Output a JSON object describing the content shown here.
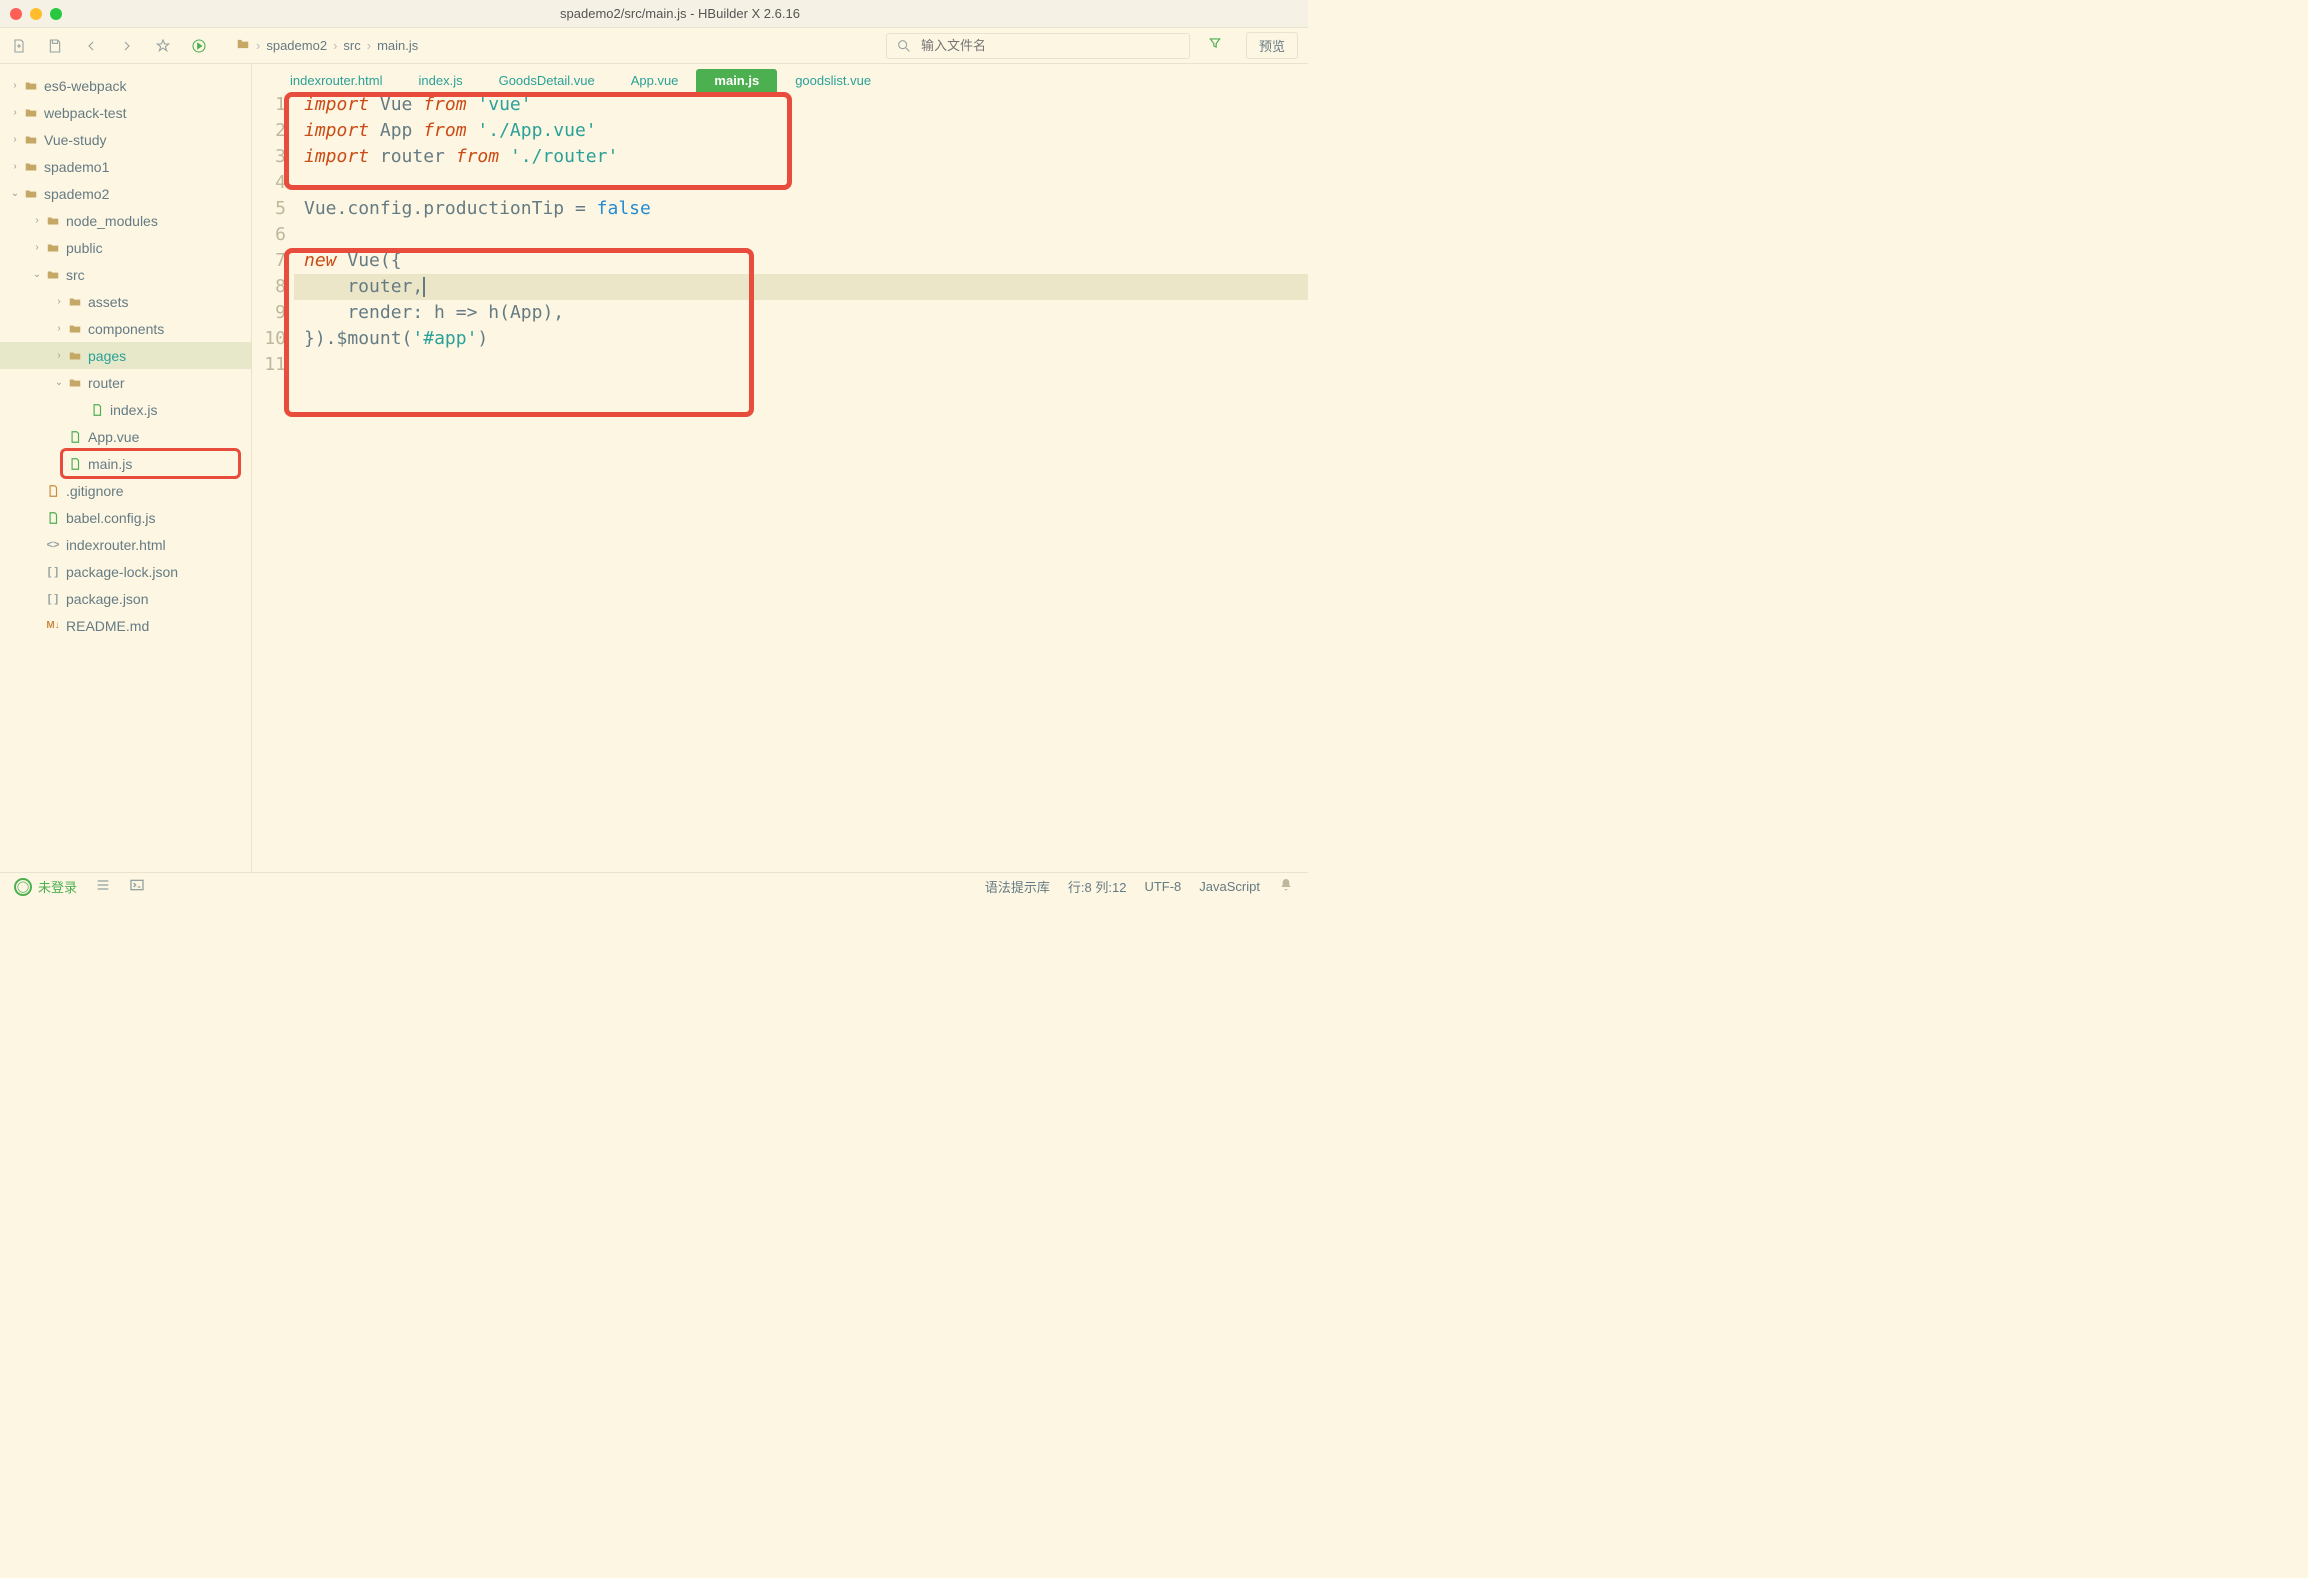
{
  "window": {
    "title": "spademo2/src/main.js - HBuilder X 2.6.16"
  },
  "toolbar": {
    "breadcrumb": [
      "spademo2",
      "src",
      "main.js"
    ],
    "search_placeholder": "输入文件名",
    "preview_label": "预览"
  },
  "sidebar": {
    "items": [
      {
        "depth": 0,
        "icon": "folder",
        "arrow": ">",
        "label": "es6-webpack"
      },
      {
        "depth": 0,
        "icon": "folder",
        "arrow": ">",
        "label": "webpack-test"
      },
      {
        "depth": 0,
        "icon": "folder",
        "arrow": ">",
        "label": "Vue-study"
      },
      {
        "depth": 0,
        "icon": "folder",
        "arrow": ">",
        "label": "spademo1"
      },
      {
        "depth": 0,
        "icon": "folder",
        "arrow": "v",
        "label": "spademo2"
      },
      {
        "depth": 1,
        "icon": "folder",
        "arrow": ">",
        "label": "node_modules"
      },
      {
        "depth": 1,
        "icon": "folder",
        "arrow": ">",
        "label": "public"
      },
      {
        "depth": 1,
        "icon": "folder",
        "arrow": "v",
        "label": "src"
      },
      {
        "depth": 2,
        "icon": "folder",
        "arrow": ">",
        "label": "assets"
      },
      {
        "depth": 2,
        "icon": "folder",
        "arrow": ">",
        "label": "components"
      },
      {
        "depth": 2,
        "icon": "folder",
        "arrow": ">",
        "label": "pages",
        "active": true
      },
      {
        "depth": 2,
        "icon": "folder",
        "arrow": "v",
        "label": "router"
      },
      {
        "depth": 3,
        "icon": "file-js",
        "arrow": "",
        "label": "index.js"
      },
      {
        "depth": 2,
        "icon": "file-vue",
        "arrow": "",
        "label": "App.vue"
      },
      {
        "depth": 2,
        "icon": "file-js",
        "arrow": "",
        "label": "main.js",
        "highlight": true
      },
      {
        "depth": 1,
        "icon": "file-gen",
        "arrow": "",
        "label": ".gitignore"
      },
      {
        "depth": 1,
        "icon": "file-js",
        "arrow": "",
        "label": "babel.config.js"
      },
      {
        "depth": 1,
        "icon": "file-html",
        "arrow": "",
        "label": "indexrouter.html"
      },
      {
        "depth": 1,
        "icon": "file-json",
        "arrow": "",
        "label": "package-lock.json"
      },
      {
        "depth": 1,
        "icon": "file-json",
        "arrow": "",
        "label": "package.json"
      },
      {
        "depth": 1,
        "icon": "file-md",
        "arrow": "",
        "label": "README.md"
      }
    ]
  },
  "tabs": [
    {
      "label": "indexrouter.html"
    },
    {
      "label": "index.js"
    },
    {
      "label": "GoodsDetail.vue"
    },
    {
      "label": "App.vue"
    },
    {
      "label": "main.js",
      "active": true
    },
    {
      "label": "goodslist.vue"
    }
  ],
  "code": {
    "cursor_line": 8,
    "lines": [
      {
        "n": 1,
        "tokens": [
          [
            "kw",
            "import"
          ],
          [
            "id",
            " Vue "
          ],
          [
            "kw2",
            "from"
          ],
          [
            "id",
            " "
          ],
          [
            "str",
            "'vue'"
          ]
        ]
      },
      {
        "n": 2,
        "tokens": [
          [
            "kw",
            "import"
          ],
          [
            "id",
            " App "
          ],
          [
            "kw2",
            "from"
          ],
          [
            "id",
            " "
          ],
          [
            "str",
            "'./App.vue'"
          ]
        ]
      },
      {
        "n": 3,
        "tokens": [
          [
            "kw",
            "import"
          ],
          [
            "id",
            " router "
          ],
          [
            "kw2",
            "from"
          ],
          [
            "id",
            " "
          ],
          [
            "str",
            "'./router'"
          ]
        ]
      },
      {
        "n": 4,
        "tokens": []
      },
      {
        "n": 5,
        "tokens": [
          [
            "id",
            "Vue"
          ],
          [
            "punct",
            "."
          ],
          [
            "id",
            "config"
          ],
          [
            "punct",
            "."
          ],
          [
            "id",
            "productionTip "
          ],
          [
            "op",
            "="
          ],
          [
            "id",
            " "
          ],
          [
            "bool",
            "false"
          ]
        ]
      },
      {
        "n": 6,
        "tokens": []
      },
      {
        "n": 7,
        "tokens": [
          [
            "kw",
            "new"
          ],
          [
            "id",
            " Vue"
          ],
          [
            "punct",
            "({"
          ]
        ]
      },
      {
        "n": 8,
        "highlight": true,
        "tokens": [
          [
            "id",
            "    router"
          ],
          [
            "punct",
            ","
          ]
        ],
        "cursor": true
      },
      {
        "n": 9,
        "tokens": [
          [
            "id",
            "    render"
          ],
          [
            "punct",
            ":"
          ],
          [
            "id",
            " h "
          ],
          [
            "op",
            "=>"
          ],
          [
            "id",
            " h"
          ],
          [
            "punct",
            "("
          ],
          [
            "id",
            "App"
          ],
          [
            "punct",
            "),"
          ]
        ]
      },
      {
        "n": 10,
        "tokens": [
          [
            "punct",
            "})."
          ],
          [
            "id",
            "$mount"
          ],
          [
            "punct",
            "("
          ],
          [
            "str",
            "'#app'"
          ],
          [
            "punct",
            ")"
          ]
        ]
      },
      {
        "n": 11,
        "tokens": []
      }
    ]
  },
  "statusbar": {
    "login": "未登录",
    "hint_lib": "语法提示库",
    "cursor_pos": "行:8  列:12",
    "encoding": "UTF-8",
    "language": "JavaScript"
  }
}
